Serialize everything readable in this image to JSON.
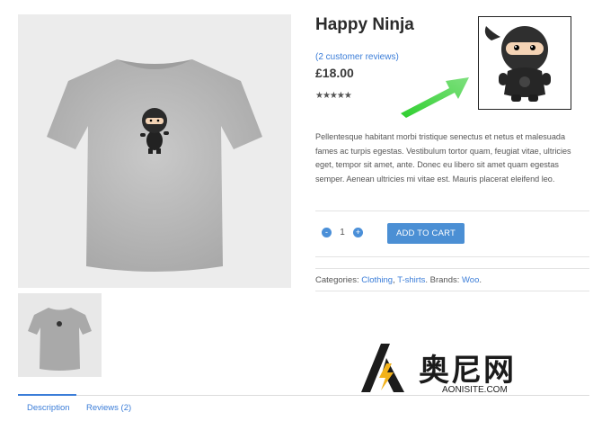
{
  "product": {
    "title": "Happy Ninja",
    "reviews_link": "(2 customer reviews)",
    "price": "£18.00",
    "rating_stars": "★★★★★",
    "description": "Pellentesque habitant morbi tristique senectus et netus et malesuada fames ac turpis egestas. Vestibulum tortor quam, feugiat vitae, ultricies eget, tempor sit amet, ante. Donec eu libero sit amet quam egestas semper. Aenean ultricies mi vitae est. Mauris placerat eleifend leo.",
    "quantity": "1"
  },
  "cart": {
    "add_label": "ADD TO CART",
    "minus": "-",
    "plus": "+"
  },
  "meta": {
    "categories_label": "Categories:",
    "category_1": "Clothing",
    "separator": ",",
    "category_2": "T-shirts",
    "brands_label": ". Brands:",
    "brand_1": "Woo",
    "end": "."
  },
  "tabs": {
    "description": "Description",
    "reviews": "Reviews (2)"
  },
  "watermark": {
    "text": "奥尼网",
    "url": "AONISITE.COM"
  },
  "colors": {
    "accent": "#3b7dd8",
    "button": "#4b8fd4",
    "arrow": "#33cc33"
  }
}
